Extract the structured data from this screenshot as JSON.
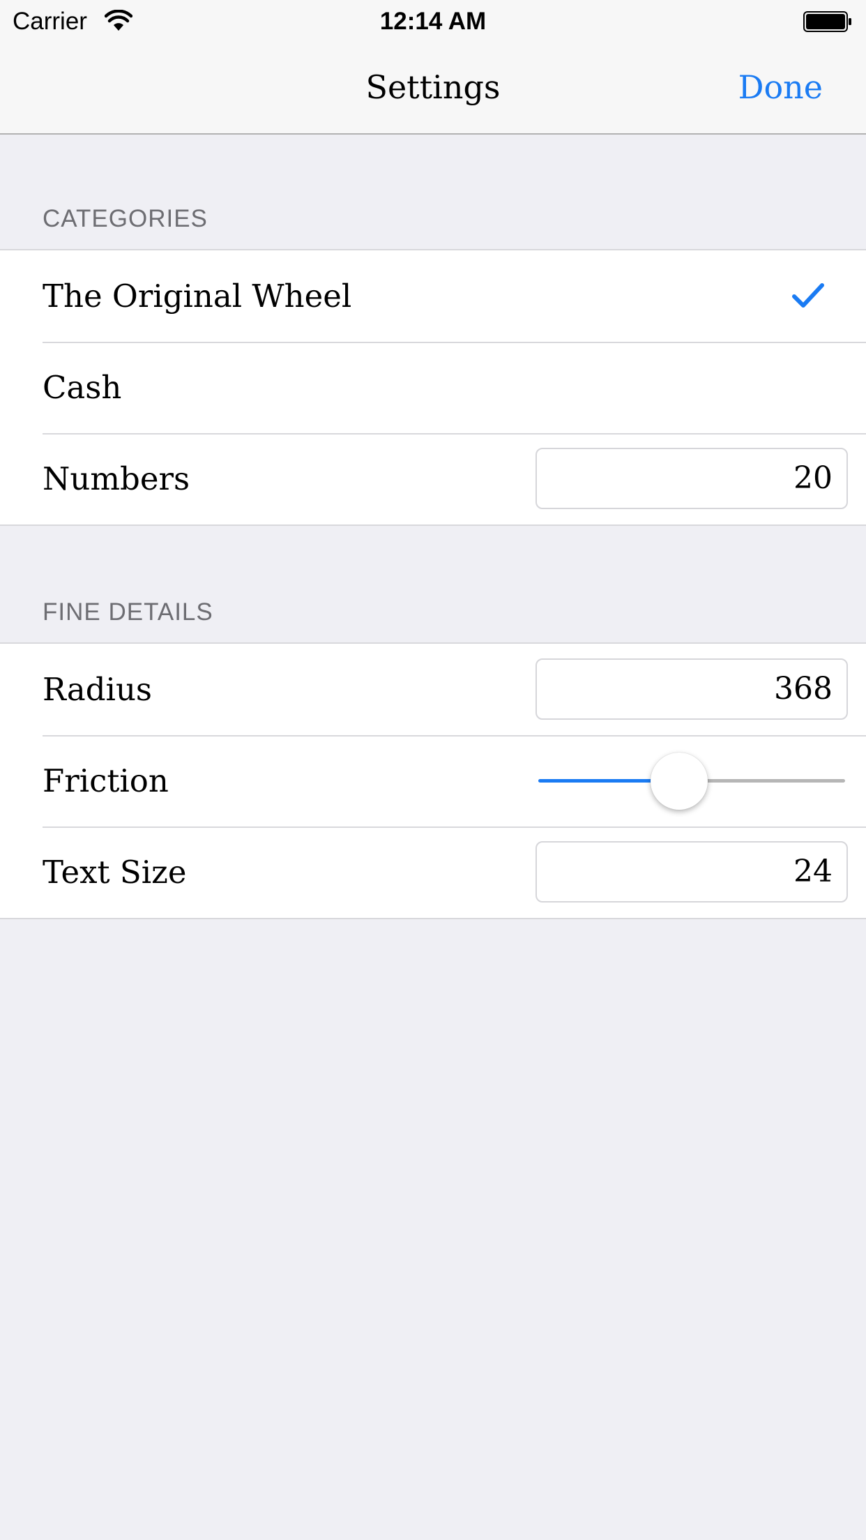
{
  "status_bar": {
    "carrier": "Carrier",
    "time": "12:14 AM",
    "wifi_icon": "wifi-icon",
    "battery_icon": "battery-icon"
  },
  "nav": {
    "title": "Settings",
    "done_label": "Done"
  },
  "colors": {
    "accent": "#1a7bf3",
    "background": "#efeff4",
    "section_header": "#6d6d72"
  },
  "sections": [
    {
      "header": "CATEGORIES",
      "rows": [
        {
          "label": "The Original Wheel",
          "accessory": "checkmark-icon"
        },
        {
          "label": "Cash"
        },
        {
          "label": "Numbers",
          "value": "20"
        }
      ]
    },
    {
      "header": "FINE DETAILS",
      "rows": [
        {
          "label": "Radius",
          "value": "368"
        },
        {
          "label": "Friction",
          "slider_fraction": 0.45
        },
        {
          "label": "Text Size",
          "value": "24"
        }
      ]
    }
  ]
}
